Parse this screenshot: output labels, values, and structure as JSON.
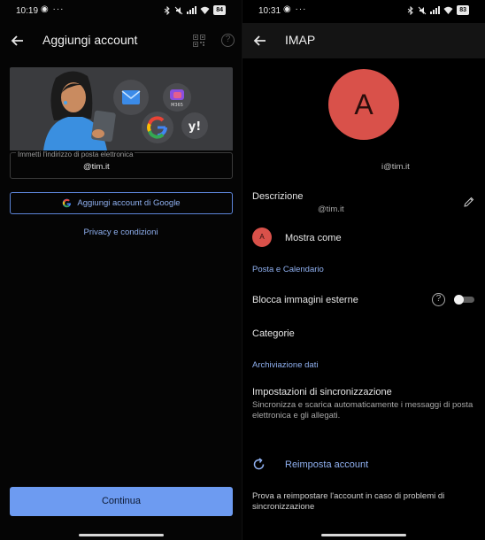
{
  "left": {
    "status": {
      "time": "10:19",
      "dots": "◉ ···",
      "battery": "84"
    },
    "title": "Aggiungi account",
    "email_label": "Immetti l'indirizzo di posta elettronica",
    "email_value": "@tim.it",
    "google_button": "Aggiungi account di Google",
    "privacy_link": "Privacy e condizioni",
    "continue_button": "Continua",
    "illustration": {
      "m365_label": "M365",
      "yahoo_label": "y!"
    }
  },
  "right": {
    "status": {
      "time": "10:31",
      "dots": "◉ ···",
      "battery": "83"
    },
    "title": "IMAP",
    "avatar_letter": "A",
    "account_email": "i@tim.it",
    "description_title": "Descrizione",
    "description_value": "@tim.it",
    "show_as": "Mostra come",
    "section_mail": "Posta e Calendario",
    "block_images": "Blocca immagini esterne",
    "block_images_enabled": false,
    "categories": "Categorie",
    "section_storage": "Archiviazione dati",
    "sync_title": "Impostazioni di sincronizzazione",
    "sync_desc": "Sincronizza e scarica automaticamente i messaggi di posta elettronica e gli allegati.",
    "reset_label": "Reimposta account",
    "reset_desc": "Prova a reimpostare l'account in caso di problemi di sincronizzazione"
  },
  "colors": {
    "accent": "#8fb0f0",
    "primary_button": "#6d9bf1",
    "avatar": "#d9514a"
  }
}
